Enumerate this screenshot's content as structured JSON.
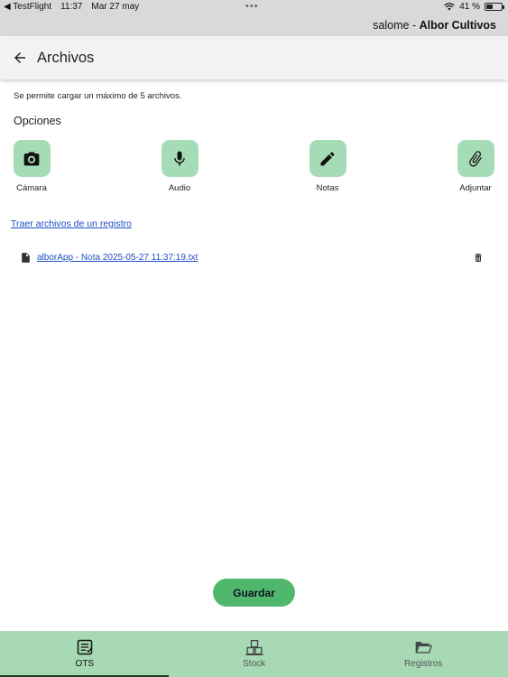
{
  "status_bar": {
    "back_app": "◀ TestFlight",
    "time": "11:37",
    "date": "Mar 27 may",
    "dots": "•••",
    "battery": "41 %",
    "battery_level": 0.41
  },
  "header": {
    "user": "salome -",
    "company": "Albor Cultivos"
  },
  "appbar": {
    "title": "Archivos"
  },
  "main": {
    "limit_text": "Se permite cargar un máximo de 5 archivos.",
    "options_title": "Opciones",
    "options": [
      {
        "label": "Cámara",
        "icon": "camera-icon"
      },
      {
        "label": "Audio",
        "icon": "microphone-icon"
      },
      {
        "label": "Notas",
        "icon": "pencil-icon"
      },
      {
        "label": "Adjuntar",
        "icon": "paperclip-icon"
      }
    ],
    "link_traer": "Traer archivos de un registro",
    "files": [
      {
        "name": "alborApp - Nota 2025-05-27 11:37:19.txt"
      }
    ],
    "save_label": "Guardar"
  },
  "bottom_nav": [
    {
      "label": "OTS",
      "icon": "document-list-icon",
      "active": true
    },
    {
      "label": "Stock",
      "icon": "boxes-icon",
      "active": false
    },
    {
      "label": "Registros",
      "icon": "folder-open-icon",
      "active": false
    }
  ],
  "colors": {
    "accent_green": "#a6dcb5",
    "save_green": "#4fb86d",
    "nav_green": "#a6d9b4",
    "link_blue": "#1f4fc4"
  }
}
